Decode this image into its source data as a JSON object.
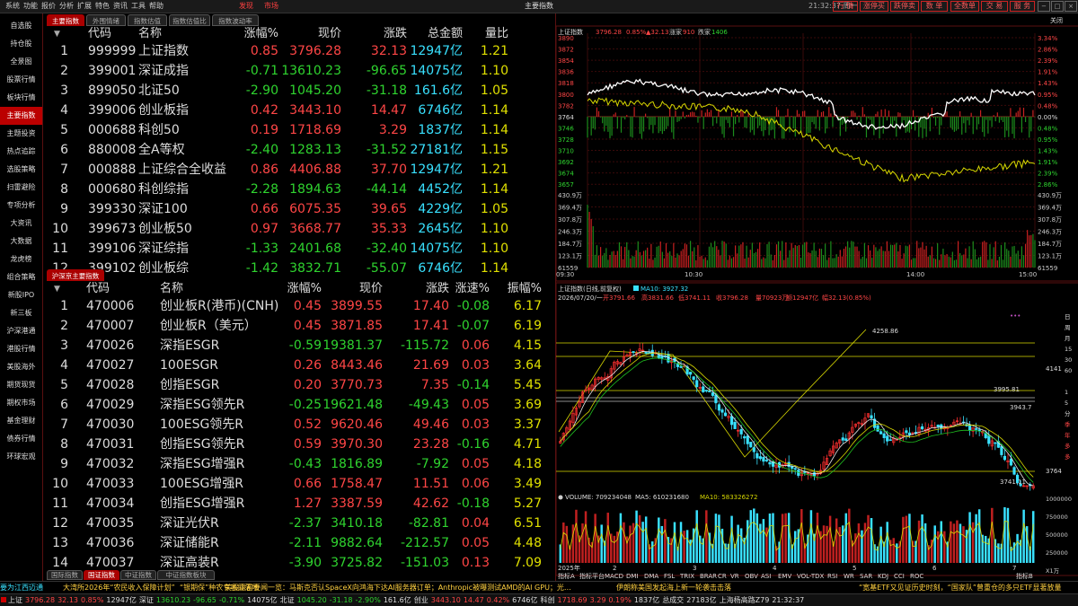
{
  "menu": {
    "items": [
      "系统",
      "功能",
      "报价",
      "分析",
      "扩展",
      "特色",
      "资讯",
      "工具",
      "帮助"
    ],
    "hot": [
      "发现",
      "市场"
    ],
    "title": "主要指数",
    "clock": "21:32:37 周一",
    "buttons": [
      "行 情",
      "涨停买",
      "跌停卖",
      "数 单",
      "全数单",
      "交 易",
      "服 务"
    ]
  },
  "sidebar": {
    "items": [
      "自选股",
      "持仓股",
      "全景图",
      "股票行情",
      "板块行情",
      "主要指数",
      "主题投资",
      "热点追踪",
      "选股策略",
      "扫雷避险",
      "专项分析",
      "大资讯",
      "大数据",
      "龙虎榜",
      "组合策略",
      "新股IPO",
      "新三板",
      "沪深港通",
      "港股行情",
      "美股海外",
      "期货现货",
      "期权市场",
      "基金理财",
      "债券行情",
      "环球宏观"
    ],
    "active_index": 5
  },
  "top_tabs": [
    "主要指数",
    "外围情绪",
    "指数估值",
    "指数估值比",
    "指数波动率"
  ],
  "table1": {
    "headers": [
      "代码",
      "名称",
      "涨幅%",
      "现价",
      "涨跌",
      "总金额",
      "量比"
    ],
    "rows": [
      {
        "n": "1",
        "code": "999999",
        "name": "上证指数",
        "pct": "0.85",
        "price": "3796.28",
        "chg": "32.13",
        "amt": "12947亿",
        "vr": "1.21",
        "dir": "up"
      },
      {
        "n": "2",
        "code": "399001",
        "name": "深证成指",
        "pct": "-0.71",
        "price": "13610.23",
        "chg": "-96.65",
        "amt": "14075亿",
        "vr": "1.10",
        "dir": "dn"
      },
      {
        "n": "3",
        "code": "899050",
        "name": "北证50",
        "pct": "-2.90",
        "price": "1045.20",
        "chg": "-31.18",
        "amt": "161.6亿",
        "vr": "1.05",
        "dir": "dn"
      },
      {
        "n": "4",
        "code": "399006",
        "name": "创业板指",
        "pct": "0.42",
        "price": "3443.10",
        "chg": "14.47",
        "amt": "6746亿",
        "vr": "1.14",
        "dir": "up"
      },
      {
        "n": "5",
        "code": "000688",
        "name": "科创50",
        "pct": "0.19",
        "price": "1718.69",
        "chg": "3.29",
        "amt": "1837亿",
        "vr": "1.14",
        "dir": "up"
      },
      {
        "n": "6",
        "code": "880008",
        "name": "全A等权",
        "pct": "-2.40",
        "price": "1283.13",
        "chg": "-31.52",
        "amt": "27181亿",
        "vr": "1.15",
        "dir": "dn"
      },
      {
        "n": "7",
        "code": "000888",
        "name": "上证综合全收益",
        "pct": "0.86",
        "price": "4406.88",
        "chg": "37.70",
        "amt": "12947亿",
        "vr": "1.21",
        "dir": "up"
      },
      {
        "n": "8",
        "code": "000680",
        "name": "科创综指",
        "pct": "-2.28",
        "price": "1894.63",
        "chg": "-44.14",
        "amt": "4452亿",
        "vr": "1.14",
        "dir": "dn"
      },
      {
        "n": "9",
        "code": "399330",
        "name": "深证100",
        "pct": "0.66",
        "price": "6075.35",
        "chg": "39.65",
        "amt": "4229亿",
        "vr": "1.05",
        "dir": "up"
      },
      {
        "n": "10",
        "code": "399673",
        "name": "创业板50",
        "pct": "0.97",
        "price": "3668.77",
        "chg": "35.33",
        "amt": "2645亿",
        "vr": "1.10",
        "dir": "up"
      },
      {
        "n": "11",
        "code": "399106",
        "name": "深证综指",
        "pct": "-1.33",
        "price": "2401.68",
        "chg": "-32.40",
        "amt": "14075亿",
        "vr": "1.10",
        "dir": "dn"
      },
      {
        "n": "12",
        "code": "399102",
        "name": "创业板综",
        "pct": "-1.42",
        "price": "3832.71",
        "chg": "-55.07",
        "amt": "6746亿",
        "vr": "1.14",
        "dir": "dn"
      }
    ]
  },
  "mid_tab": "沪深京主要指数",
  "table2": {
    "headers": [
      "代码",
      "名称",
      "涨幅%",
      "现价",
      "涨跌",
      "涨速%",
      "振幅%"
    ],
    "rows": [
      {
        "n": "1",
        "code": "470006",
        "name": "创业板R(港币)(CNH)",
        "pct": "0.45",
        "price": "3899.55",
        "chg": "17.40",
        "spd": "-0.08",
        "amp": "6.17",
        "dir": "up",
        "sdir": "dn"
      },
      {
        "n": "2",
        "code": "470007",
        "name": "创业板R（美元）",
        "pct": "0.45",
        "price": "3871.85",
        "chg": "17.41",
        "spd": "-0.07",
        "amp": "6.19",
        "dir": "up",
        "sdir": "dn"
      },
      {
        "n": "3",
        "code": "470026",
        "name": "深指ESGR",
        "pct": "-0.59",
        "price": "19381.37",
        "chg": "-115.72",
        "spd": "0.06",
        "amp": "4.15",
        "dir": "dn",
        "sdir": "up"
      },
      {
        "n": "4",
        "code": "470027",
        "name": "100ESGR",
        "pct": "0.26",
        "price": "8443.46",
        "chg": "21.69",
        "spd": "0.03",
        "amp": "3.64",
        "dir": "up",
        "sdir": "up"
      },
      {
        "n": "5",
        "code": "470028",
        "name": "创指ESGR",
        "pct": "0.20",
        "price": "3770.73",
        "chg": "7.35",
        "spd": "-0.14",
        "amp": "5.45",
        "dir": "up",
        "sdir": "dn"
      },
      {
        "n": "6",
        "code": "470029",
        "name": "深指ESG领先R",
        "pct": "-0.25",
        "price": "19621.48",
        "chg": "-49.43",
        "spd": "0.05",
        "amp": "3.69",
        "dir": "dn",
        "sdir": "up"
      },
      {
        "n": "7",
        "code": "470030",
        "name": "100ESG领先R",
        "pct": "0.52",
        "price": "9620.46",
        "chg": "49.46",
        "spd": "0.03",
        "amp": "3.37",
        "dir": "up",
        "sdir": "up"
      },
      {
        "n": "8",
        "code": "470031",
        "name": "创指ESG领先R",
        "pct": "0.59",
        "price": "3970.30",
        "chg": "23.28",
        "spd": "-0.16",
        "amp": "4.71",
        "dir": "up",
        "sdir": "dn"
      },
      {
        "n": "9",
        "code": "470032",
        "name": "深指ESG增强R",
        "pct": "-0.43",
        "price": "1816.89",
        "chg": "-7.92",
        "spd": "0.05",
        "amp": "4.18",
        "dir": "dn",
        "sdir": "up"
      },
      {
        "n": "10",
        "code": "470033",
        "name": "100ESG增强R",
        "pct": "0.66",
        "price": "1758.47",
        "chg": "11.51",
        "spd": "0.06",
        "amp": "3.49",
        "dir": "up",
        "sdir": "up"
      },
      {
        "n": "11",
        "code": "470034",
        "name": "创指ESG增强R",
        "pct": "1.27",
        "price": "3387.59",
        "chg": "42.62",
        "spd": "-0.18",
        "amp": "5.27",
        "dir": "up",
        "sdir": "dn"
      },
      {
        "n": "12",
        "code": "470035",
        "name": "深证光伏R",
        "pct": "-2.37",
        "price": "3410.18",
        "chg": "-82.81",
        "spd": "0.04",
        "amp": "6.51",
        "dir": "dn",
        "sdir": "up"
      },
      {
        "n": "13",
        "code": "470036",
        "name": "深证储能R",
        "pct": "-2.11",
        "price": "9882.64",
        "chg": "-212.57",
        "spd": "0.05",
        "amp": "4.48",
        "dir": "dn",
        "sdir": "up"
      },
      {
        "n": "14",
        "code": "470037",
        "name": "深证高装R",
        "pct": "-3.90",
        "price": "3725.82",
        "chg": "-151.03",
        "spd": "0.13",
        "amp": "7.09",
        "dir": "dn",
        "sdir": "up"
      }
    ]
  },
  "bottom_tabs": [
    "国际指数",
    "国证指数",
    "中证指数",
    "中证指数板块"
  ],
  "intraday": {
    "header": [
      "上证指数",
      "3796.28",
      "0.85%",
      "▲32.13",
      "涨家",
      "910",
      "跌家",
      "1406"
    ],
    "left_axis": [
      "3890",
      "3872",
      "3854",
      "3836",
      "3818",
      "3800",
      "3782",
      "3764",
      "3746",
      "3728",
      "3710",
      "3692",
      "3674",
      "3657"
    ],
    "right_axis": [
      "3.34%",
      "2.86%",
      "2.39%",
      "1.91%",
      "1.43%",
      "0.95%",
      "0.48%",
      "0.00%",
      "0.48%",
      "0.95%",
      "1.43%",
      "1.91%",
      "2.39%",
      "2.86%"
    ],
    "vol_axis": [
      "430.9万",
      "369.4万",
      "307.8万",
      "246.3万",
      "184.7万",
      "123.1万",
      "61559"
    ],
    "time_axis": [
      "09:30",
      "10:30",
      "14:00",
      "15:00"
    ],
    "close_label": "关闭"
  },
  "kline": {
    "title": "上证指数(日线,前复权)",
    "header": [
      "2026/07/20/一",
      "开3791.66",
      "高3831.66",
      "低3741.11",
      "收3796.28",
      "量70923万",
      "额12947亿",
      "幅32.13(0.85%)"
    ],
    "ma": "MA10: 3927.32",
    "high_label": "4258.86",
    "low_label": "3741.11",
    "mark1": "3995.81",
    "mark2": "3943.7",
    "right_axis": [
      "4141",
      "3764"
    ],
    "right_menu": [
      "日",
      "周",
      "月",
      "15",
      "30",
      "60",
      "1",
      "5",
      "分",
      "季",
      "年",
      "多",
      "多"
    ]
  },
  "volume": {
    "header": [
      "VOLUME: 709234048",
      "MA5: 610231680",
      "MA10: 583326272"
    ],
    "axis": [
      "1000000",
      "750000",
      "500000",
      "250000",
      "X1万"
    ],
    "year_label": "2025年",
    "months": [
      "2",
      "3",
      "4",
      "5",
      "6",
      "7"
    ],
    "indicators": [
      "指标A",
      "指标平台",
      "MACD",
      "DMI",
      "DMA",
      "FSL",
      "TRIX",
      "BRAR",
      "CR",
      "VR",
      "OBV",
      "ASI",
      "EMV",
      "VOL-TDX",
      "RSI",
      "WR",
      "SAR",
      "KDJ",
      "CCI",
      "ROC",
      "指标B"
    ]
  },
  "ticker": [
    "要为江西迈通",
    "大湾所2026年“农民收入保障计划”",
    "“银期保”种农专项目落地",
    "美股盘前要闻一览：马斯克否认SpaceX向鸿海下达AI服务器订单；Anthropic被曝测试AMD的AI GPU；光…",
    "伊朗称美国发起海上新一轮袭击击落",
    "“宽基ETF又见证历史时刻，“国家队”曾重仓的多只ETF显著放量"
  ],
  "status": [
    {
      "t": "上证",
      "c": "wh"
    },
    {
      "t": "3796.28",
      "c": "up"
    },
    {
      "t": "32.13",
      "c": "up"
    },
    {
      "t": "0.85%",
      "c": "up"
    },
    {
      "t": "12947亿",
      "c": "wh"
    },
    {
      "t": "深证",
      "c": "wh"
    },
    {
      "t": "13610.23",
      "c": "dn"
    },
    {
      "t": "-96.65",
      "c": "dn"
    },
    {
      "t": "-0.71%",
      "c": "dn"
    },
    {
      "t": "14075亿",
      "c": "wh"
    },
    {
      "t": "北证",
      "c": "wh"
    },
    {
      "t": "1045.20",
      "c": "dn"
    },
    {
      "t": "-31.18",
      "c": "dn"
    },
    {
      "t": "-2.90%",
      "c": "dn"
    },
    {
      "t": "161.6亿",
      "c": "wh"
    },
    {
      "t": "创业",
      "c": "wh"
    },
    {
      "t": "3443.10",
      "c": "up"
    },
    {
      "t": "14.47",
      "c": "up"
    },
    {
      "t": "0.42%",
      "c": "up"
    },
    {
      "t": "6746亿",
      "c": "wh"
    },
    {
      "t": "科创",
      "c": "wh"
    },
    {
      "t": "1718.69",
      "c": "up"
    },
    {
      "t": "3.29",
      "c": "up"
    },
    {
      "t": "0.19%",
      "c": "up"
    },
    {
      "t": "1837亿",
      "c": "wh"
    },
    {
      "t": "总成交",
      "c": "wh"
    },
    {
      "t": "27183亿",
      "c": "wh"
    },
    {
      "t": "上海杨高路Z79",
      "c": "wh"
    },
    {
      "t": "21:32:37",
      "c": "wh"
    }
  ],
  "colors": {
    "up": "#ff4646",
    "down": "#2fd42f",
    "cyan": "#39e1ff",
    "accent": "#b00000",
    "yellow": "#e0e000"
  }
}
